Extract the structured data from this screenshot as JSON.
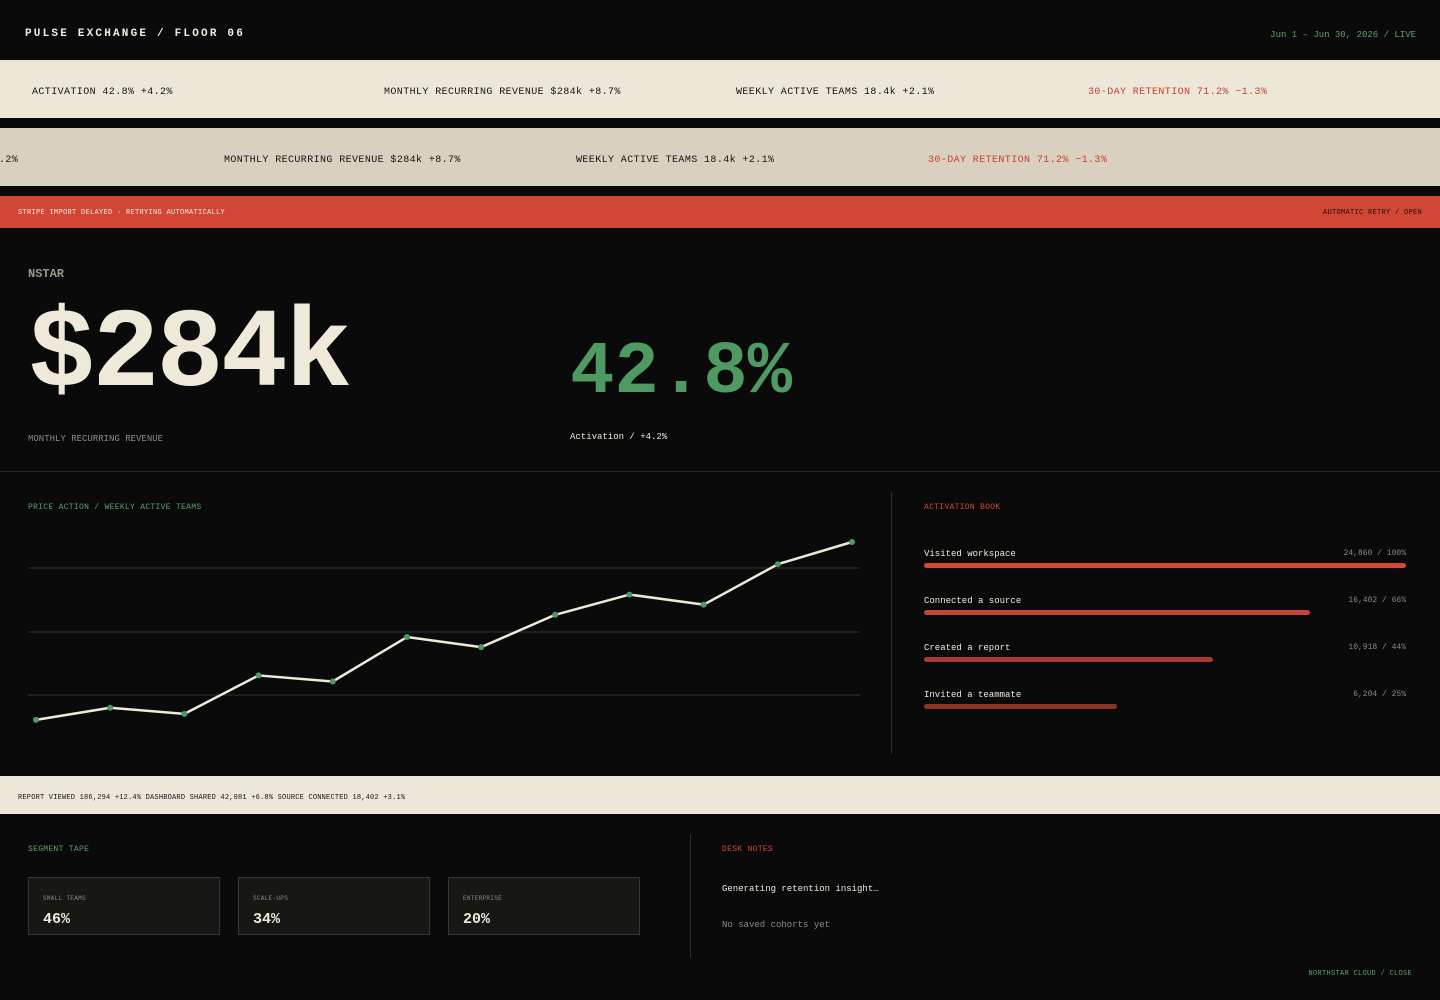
{
  "header": {
    "brand": "PULSE EXCHANGE / FLOOR 06",
    "date_range": "Jun 1 – Jun 30, 2026 / LIVE"
  },
  "ticker_primary": [
    {
      "text": "ACTIVATION 42.8% +4.2%",
      "direction": "up"
    },
    {
      "text": "MONTHLY RECURRING REVENUE $284k +8.7%",
      "direction": "up"
    },
    {
      "text": "WEEKLY ACTIVE TEAMS 18.4k +2.1%",
      "direction": "up"
    },
    {
      "text": "30-DAY RETENTION 71.2% −1.3%",
      "direction": "down"
    }
  ],
  "ticker_secondary": [
    {
      "text": ".2%",
      "direction": "up"
    },
    {
      "text": "MONTHLY RECURRING REVENUE $284k +8.7%",
      "direction": "up"
    },
    {
      "text": "WEEKLY ACTIVE TEAMS 18.4k +2.1%",
      "direction": "up"
    },
    {
      "text": "30-DAY RETENTION 71.2% −1.3%",
      "direction": "down"
    }
  ],
  "alert": {
    "message": "STRIPE IMPORT DELAYED · RETRYING AUTOMATICALLY",
    "action": "AUTOMATIC RETRY / OPEN"
  },
  "hero": {
    "label": "NSTAR",
    "primary_value": "$284k",
    "primary_caption": "MONTHLY RECURRING REVENUE",
    "secondary_value": "42.8%",
    "secondary_caption": "Activation / +4.2%"
  },
  "price_action": {
    "title": "PRICE ACTION / WEEKLY ACTIVE TEAMS"
  },
  "chart_data": {
    "type": "line",
    "title": "PRICE ACTION / WEEKLY ACTIVE TEAMS",
    "xlabel": "",
    "ylabel": "",
    "x": [
      1,
      2,
      3,
      4,
      5,
      6,
      7,
      8,
      9,
      10,
      11,
      12
    ],
    "series": [
      {
        "values": [
          15.0,
          15.3,
          15.15,
          16.1,
          15.95,
          17.05,
          16.8,
          17.6,
          18.1,
          17.85,
          18.85,
          19.4
        ]
      }
    ],
    "ylim": [
      14.8,
      19.4
    ],
    "grid": true,
    "legend": "none"
  },
  "activation_book": {
    "title": "ACTIVATION BOOK",
    "rows": [
      {
        "label": "Visited workspace",
        "value": "24,860 / 100%",
        "fraction": 1.0,
        "color": "#d44a38"
      },
      {
        "label": "Connected a source",
        "value": "16,402 / 66%",
        "fraction": 0.8,
        "color": "#c24535"
      },
      {
        "label": "Created a report",
        "value": "10,918 / 44%",
        "fraction": 0.6,
        "color": "#a63b2e"
      },
      {
        "label": "Invited a teammate",
        "value": "6,204 / 25%",
        "fraction": 0.4,
        "color": "#8c3327"
      }
    ]
  },
  "events": {
    "text": "REPORT VIEWED 186,294 +12.4% DASHBOARD SHARED 42,081 +6.8% SOURCE CONNECTED 18,402 +3.1%"
  },
  "segments": {
    "title": "SEGMENT TAPE",
    "items": [
      {
        "name": "SMALL TEAMS",
        "value": "46%"
      },
      {
        "name": "SCALE-UPS",
        "value": "34%"
      },
      {
        "name": "ENTERPRISE",
        "value": "20%"
      }
    ]
  },
  "desk_notes": {
    "title": "DESK NOTES",
    "status": "Generating retention insight…",
    "empty": "No saved cohorts yet"
  },
  "footer": {
    "link": "NORTHSTAR CLOUD / CLOSE"
  },
  "colors": {
    "background": "#0a0a0a",
    "cream": "#efe9da",
    "accent_green": "#4f9a62",
    "accent_red": "#d24636"
  }
}
